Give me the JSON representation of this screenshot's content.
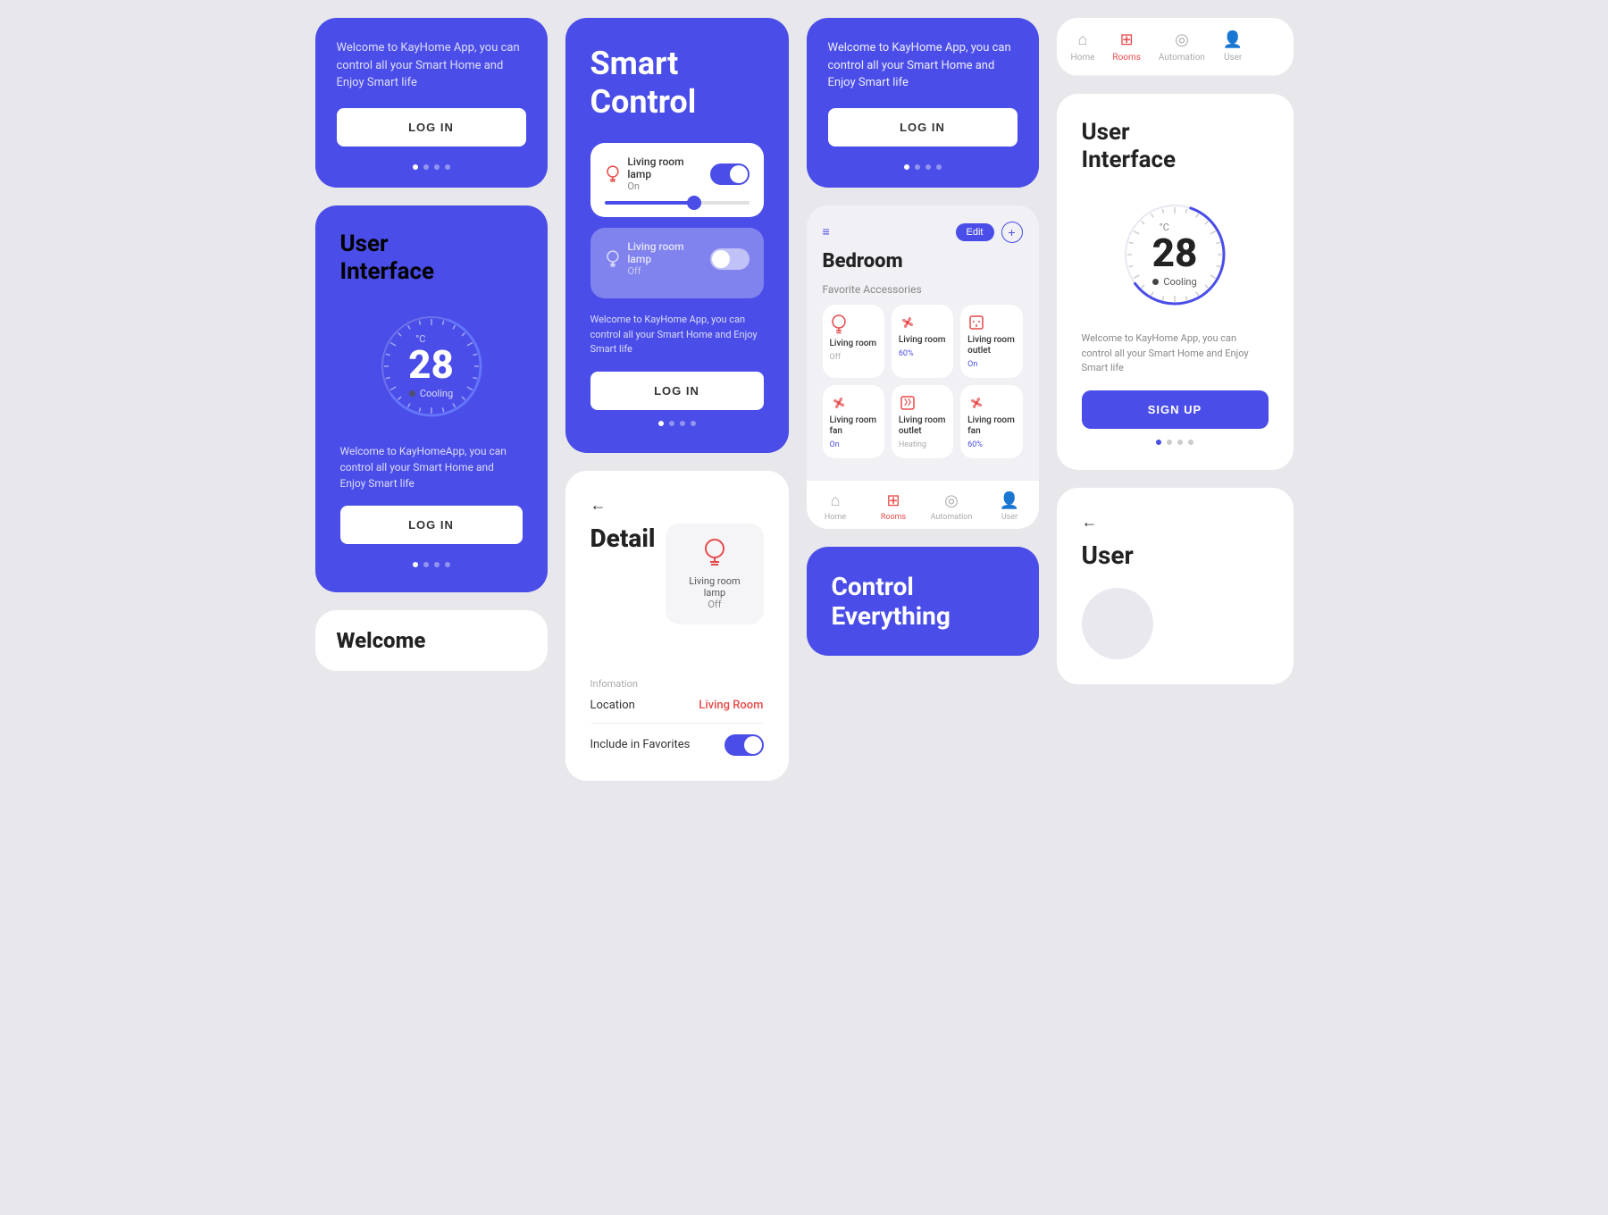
{
  "col1": {
    "card1": {
      "welcome": "Welcome to KayHome App, you can control all your Smart Home and Enjoy Smart life",
      "login": "LOG IN",
      "dots": [
        false,
        false,
        false,
        false
      ]
    },
    "card2": {
      "title1": "User",
      "title2": "Interface",
      "temp": "28",
      "unit": "°C",
      "status": "Cooling",
      "welcome": "Welcome to KayHomeApp, you can control all your Smart Home and Enjoy Smart life",
      "login": "LOG IN",
      "dots": [
        false,
        false,
        false,
        false
      ]
    },
    "welcome": "Welcome"
  },
  "col2": {
    "smart_card": {
      "title1": "Smart",
      "title2": "Control",
      "device1": {
        "name": "Living room lamp",
        "status": "On",
        "on": true
      },
      "device2": {
        "name": "Living room lamp",
        "status": "Off",
        "on": false
      },
      "welcome": "Welcome to KayHome App, you can control all your Smart Home and Enjoy Smart life",
      "login": "LOG IN",
      "dots": [
        false,
        false,
        false,
        false
      ]
    },
    "detail_card": {
      "back": "←",
      "title": "Detail",
      "device_name": "Living room lamp",
      "device_status": "Off",
      "info_label": "Infomation",
      "location_key": "Location",
      "location_val": "Living Room",
      "favorites_key": "Include in Favorites",
      "toggle_on": true
    }
  },
  "col3": {
    "top_blue": {
      "welcome": "Welcome to KayHome App, you can control all your Smart Home and Enjoy Smart life",
      "login": "LOG IN",
      "dots": [
        false,
        false,
        false,
        false
      ]
    },
    "bedroom": {
      "edit": "Edit",
      "title": "Bedroom",
      "favorites_label": "Favorite Accessories",
      "accessories": [
        {
          "name": "Living room",
          "status": "Off",
          "type": "lamp"
        },
        {
          "name": "Living room",
          "status": "60%",
          "type": "fan"
        },
        {
          "name": "Living room outlet",
          "status": "On",
          "type": "outlet"
        },
        {
          "name": "Living room fan",
          "status": "On",
          "type": "fan"
        },
        {
          "name": "Living room outlet",
          "status": "Heating",
          "type": "outlet"
        },
        {
          "name": "Living room fan",
          "status": "60%",
          "type": "fan"
        }
      ],
      "nav": [
        {
          "label": "Home",
          "icon": "⌂",
          "active": false
        },
        {
          "label": "Rooms",
          "icon": "⊞",
          "active": true
        },
        {
          "label": "Automation",
          "icon": "◎",
          "active": false
        },
        {
          "label": "User",
          "icon": "👤",
          "active": false
        }
      ]
    },
    "control_banner": {
      "line1": "Control",
      "line2": "Everything"
    }
  },
  "col4": {
    "top_nav": {
      "items": [
        {
          "label": "Home",
          "icon": "⌂",
          "active": false
        },
        {
          "label": "Rooms",
          "icon": "⊞",
          "active": true
        },
        {
          "label": "Automation",
          "icon": "◎",
          "active": false
        },
        {
          "label": "User",
          "icon": "👤",
          "active": false
        }
      ]
    },
    "ui_card": {
      "title1": "User",
      "title2": "Interface",
      "temp": "28",
      "unit": "°C",
      "status": "Cooling",
      "welcome": "Welcome to KayHome App, you can control all your Smart Home and Enjoy Smart life",
      "signup": "SIGN UP",
      "dots": [
        false,
        false,
        false,
        false
      ]
    },
    "user_card": {
      "back": "←",
      "title": "User"
    }
  }
}
